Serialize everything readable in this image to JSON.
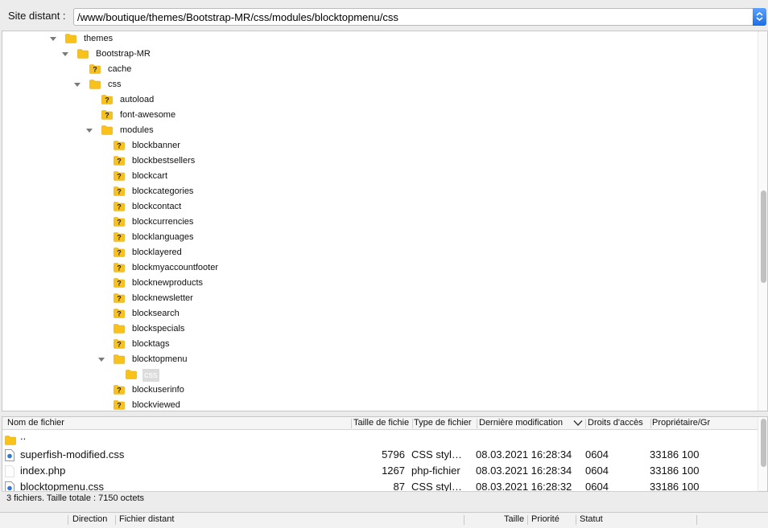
{
  "path_bar": {
    "label": "Site distant :",
    "value": "/www/boutique/themes/Bootstrap-MR/css/modules/blocktopmenu/css"
  },
  "tree": [
    {
      "label": "themes",
      "expanded": true,
      "icon": "folder-icon"
    },
    {
      "label": "Bootstrap-MR",
      "expanded": true,
      "icon": "folder-icon"
    },
    {
      "label": "cache",
      "icon": "unknown-folder-icon"
    },
    {
      "label": "css",
      "expanded": true,
      "icon": "folder-icon"
    },
    {
      "label": "autoload",
      "icon": "unknown-folder-icon"
    },
    {
      "label": "font-awesome",
      "icon": "unknown-folder-icon"
    },
    {
      "label": "modules",
      "expanded": true,
      "icon": "folder-icon"
    },
    {
      "label": "blockbanner",
      "icon": "unknown-folder-icon"
    },
    {
      "label": "blockbestsellers",
      "icon": "unknown-folder-icon"
    },
    {
      "label": "blockcart",
      "icon": "unknown-folder-icon"
    },
    {
      "label": "blockcategories",
      "icon": "unknown-folder-icon"
    },
    {
      "label": "blockcontact",
      "icon": "unknown-folder-icon"
    },
    {
      "label": "blockcurrencies",
      "icon": "unknown-folder-icon"
    },
    {
      "label": "blocklanguages",
      "icon": "unknown-folder-icon"
    },
    {
      "label": "blocklayered",
      "icon": "unknown-folder-icon"
    },
    {
      "label": "blockmyaccountfooter",
      "icon": "unknown-folder-icon"
    },
    {
      "label": "blocknewproducts",
      "icon": "unknown-folder-icon"
    },
    {
      "label": "blocknewsletter",
      "icon": "unknown-folder-icon"
    },
    {
      "label": "blocksearch",
      "icon": "unknown-folder-icon"
    },
    {
      "label": "blockspecials",
      "icon": "folder-icon"
    },
    {
      "label": "blocktags",
      "icon": "unknown-folder-icon"
    },
    {
      "label": "blocktopmenu",
      "expanded": true,
      "icon": "folder-icon"
    },
    {
      "label": "css",
      "icon": "folder-icon",
      "selected": true
    },
    {
      "label": "blockuserinfo",
      "icon": "unknown-folder-icon"
    },
    {
      "label": "blockviewed",
      "icon": "unknown-folder-icon"
    }
  ],
  "file_list": {
    "columns": [
      "Nom de fichier",
      "Taille de fichie",
      "Type de fichier",
      "Dernière modification",
      "Droits d'accès",
      "Propriétaire/Gr"
    ],
    "rows": [
      {
        "name": "..",
        "size": "",
        "type": "",
        "modified": "",
        "perms": "",
        "owner": "",
        "icon": "folder-icon"
      },
      {
        "name": "superfish-modified.css",
        "size": "5796",
        "type": "CSS styl…",
        "modified": "08.03.2021 16:28:34",
        "perms": "0604",
        "owner": "33186 100",
        "icon": "css-file-icon"
      },
      {
        "name": "index.php",
        "size": "1267",
        "type": "php-fichier",
        "modified": "08.03.2021 16:28:34",
        "perms": "0604",
        "owner": "33186 100",
        "icon": "blank-file-icon"
      },
      {
        "name": "blocktopmenu.css",
        "size": "87",
        "type": "CSS styl…",
        "modified": "08.03.2021 16:28:32",
        "perms": "0604",
        "owner": "33186 100",
        "icon": "css-file-icon"
      }
    ],
    "status": "3 fichiers. Taille totale : 7150 octets"
  },
  "queue": {
    "columns": [
      "Direction",
      "Fichier distant",
      "Taille",
      "Priorité",
      "Statut"
    ]
  },
  "colors": {
    "folder": "#f9c21b",
    "accent": "#1a6fe6",
    "selection": "#dcdcdc"
  }
}
